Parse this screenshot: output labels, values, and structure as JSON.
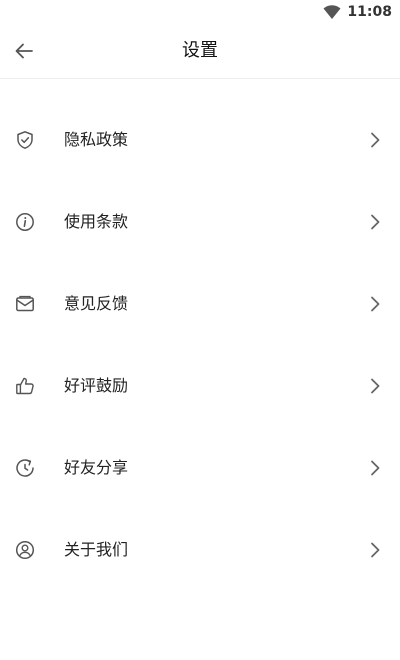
{
  "status_bar": {
    "time": "11:08",
    "icons": [
      "wifi-icon"
    ]
  },
  "header": {
    "title": "设置",
    "back_icon": "back-arrow-icon"
  },
  "menu": {
    "items": [
      {
        "label": "隐私政策",
        "icon": "shield-check-icon"
      },
      {
        "label": "使用条款",
        "icon": "info-icon"
      },
      {
        "label": "意见反馈",
        "icon": "mail-icon"
      },
      {
        "label": "好评鼓励",
        "icon": "thumbs-up-icon"
      },
      {
        "label": "好友分享",
        "icon": "share-refresh-icon"
      },
      {
        "label": "关于我们",
        "icon": "user-circle-icon"
      }
    ],
    "chevron_icon": "chevron-right-icon"
  },
  "colors": {
    "background": "#ffffff",
    "text": "#222222",
    "divider": "#eeeeee",
    "icon": "#555555",
    "chevron": "#666666"
  }
}
